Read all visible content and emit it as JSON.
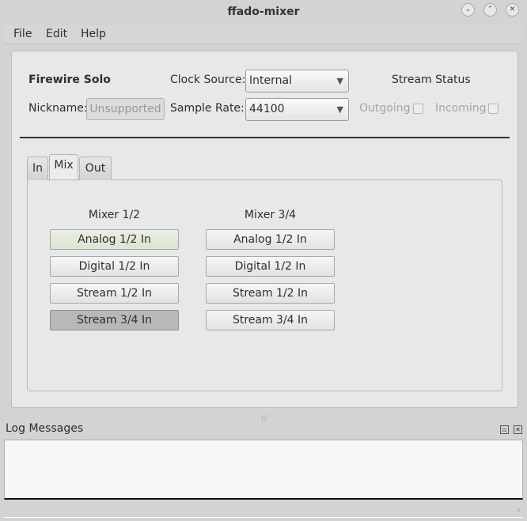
{
  "window": {
    "title": "ffado-mixer",
    "minimize_icon": "chevron-down-icon",
    "maximize_icon": "chevron-up-icon",
    "close_icon": "close-icon"
  },
  "menu": [
    "File",
    "Edit",
    "Help"
  ],
  "header": {
    "device_name": "Firewire Solo",
    "nickname_label": "Nickname:",
    "nickname_value": "Unsupported",
    "clock_label": "Clock Source:",
    "clock_value": "Internal",
    "rate_label": "Sample Rate:",
    "rate_value": "44100",
    "stream_status": "Stream Status",
    "outgoing": "Outgoing",
    "incoming": "Incoming"
  },
  "tabs": [
    "In",
    "Mix",
    "Out"
  ],
  "active_tab": "Mix",
  "mixers": [
    {
      "title": "Mixer 1/2",
      "buttons": [
        {
          "label": "Analog 1/2 In",
          "state": "highlighted"
        },
        {
          "label": "Digital 1/2 In",
          "state": "normal"
        },
        {
          "label": "Stream 1/2 In",
          "state": "normal"
        },
        {
          "label": "Stream 3/4 In",
          "state": "pressed"
        }
      ]
    },
    {
      "title": "Mixer 3/4",
      "buttons": [
        {
          "label": "Analog 1/2 In",
          "state": "normal"
        },
        {
          "label": "Digital 1/2 In",
          "state": "normal"
        },
        {
          "label": "Stream 1/2 In",
          "state": "normal"
        },
        {
          "label": "Stream 3/4 In",
          "state": "normal"
        }
      ]
    }
  ],
  "log": {
    "title": "Log Messages"
  }
}
